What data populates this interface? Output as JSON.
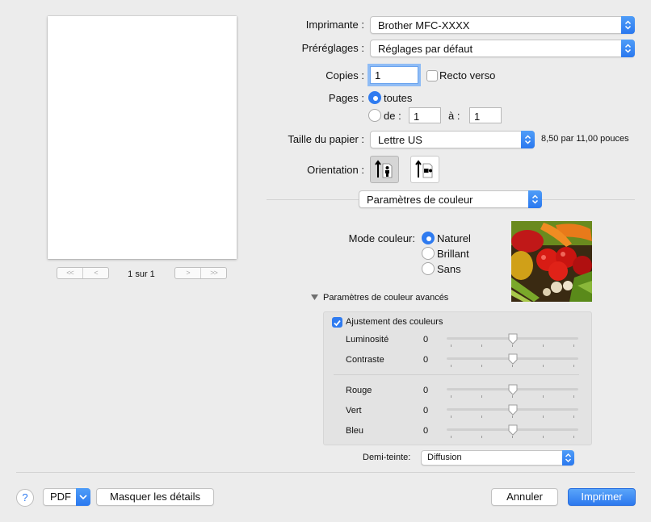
{
  "preview": {
    "page_indicator": "1 sur 1",
    "nav": [
      "<<",
      "<",
      ">",
      ">>"
    ]
  },
  "printer": {
    "label": "Imprimante :",
    "value": "Brother MFC-XXXX"
  },
  "presets": {
    "label": "Préréglages :",
    "value": "Réglages par défaut"
  },
  "copies": {
    "label": "Copies :",
    "value": "1",
    "duplex_label": "Recto verso",
    "duplex_checked": false
  },
  "pages": {
    "label": "Pages :",
    "all_label": "toutes",
    "from_label": "de :",
    "from_value": "1",
    "to_label": "à :",
    "to_value": "1",
    "selected": "all"
  },
  "paper": {
    "label": "Taille du papier :",
    "value": "Lettre US",
    "size_text": "8,50 par 11,00 pouces"
  },
  "orientation": {
    "label": "Orientation :",
    "selected": "portrait"
  },
  "panel": {
    "value": "Paramètres de couleur"
  },
  "color_mode": {
    "label": "Mode couleur:",
    "options": [
      "Naturel",
      "Brillant",
      "Sans"
    ],
    "selected": "Naturel"
  },
  "advanced": {
    "title": "Paramètres de couleur avancés",
    "adjust_label": "Ajustement des couleurs",
    "adjust_checked": true,
    "sliders": [
      {
        "label": "Luminosité",
        "value": "0",
        "level": 0.5
      },
      {
        "label": "Contraste",
        "value": "0",
        "level": 0.5
      },
      {
        "label": "Rouge",
        "value": "0",
        "level": 0.5
      },
      {
        "label": "Vert",
        "value": "0",
        "level": 0.5
      },
      {
        "label": "Bleu",
        "value": "0",
        "level": 0.5
      }
    ]
  },
  "halftone": {
    "label": "Demi-teinte:",
    "value": "Diffusion"
  },
  "footer": {
    "help": "?",
    "pdf": "PDF",
    "hide_details": "Masquer les détails",
    "cancel": "Annuler",
    "print": "Imprimer"
  },
  "colors": {
    "accent": "#2f7bf0",
    "background": "#ececec"
  }
}
